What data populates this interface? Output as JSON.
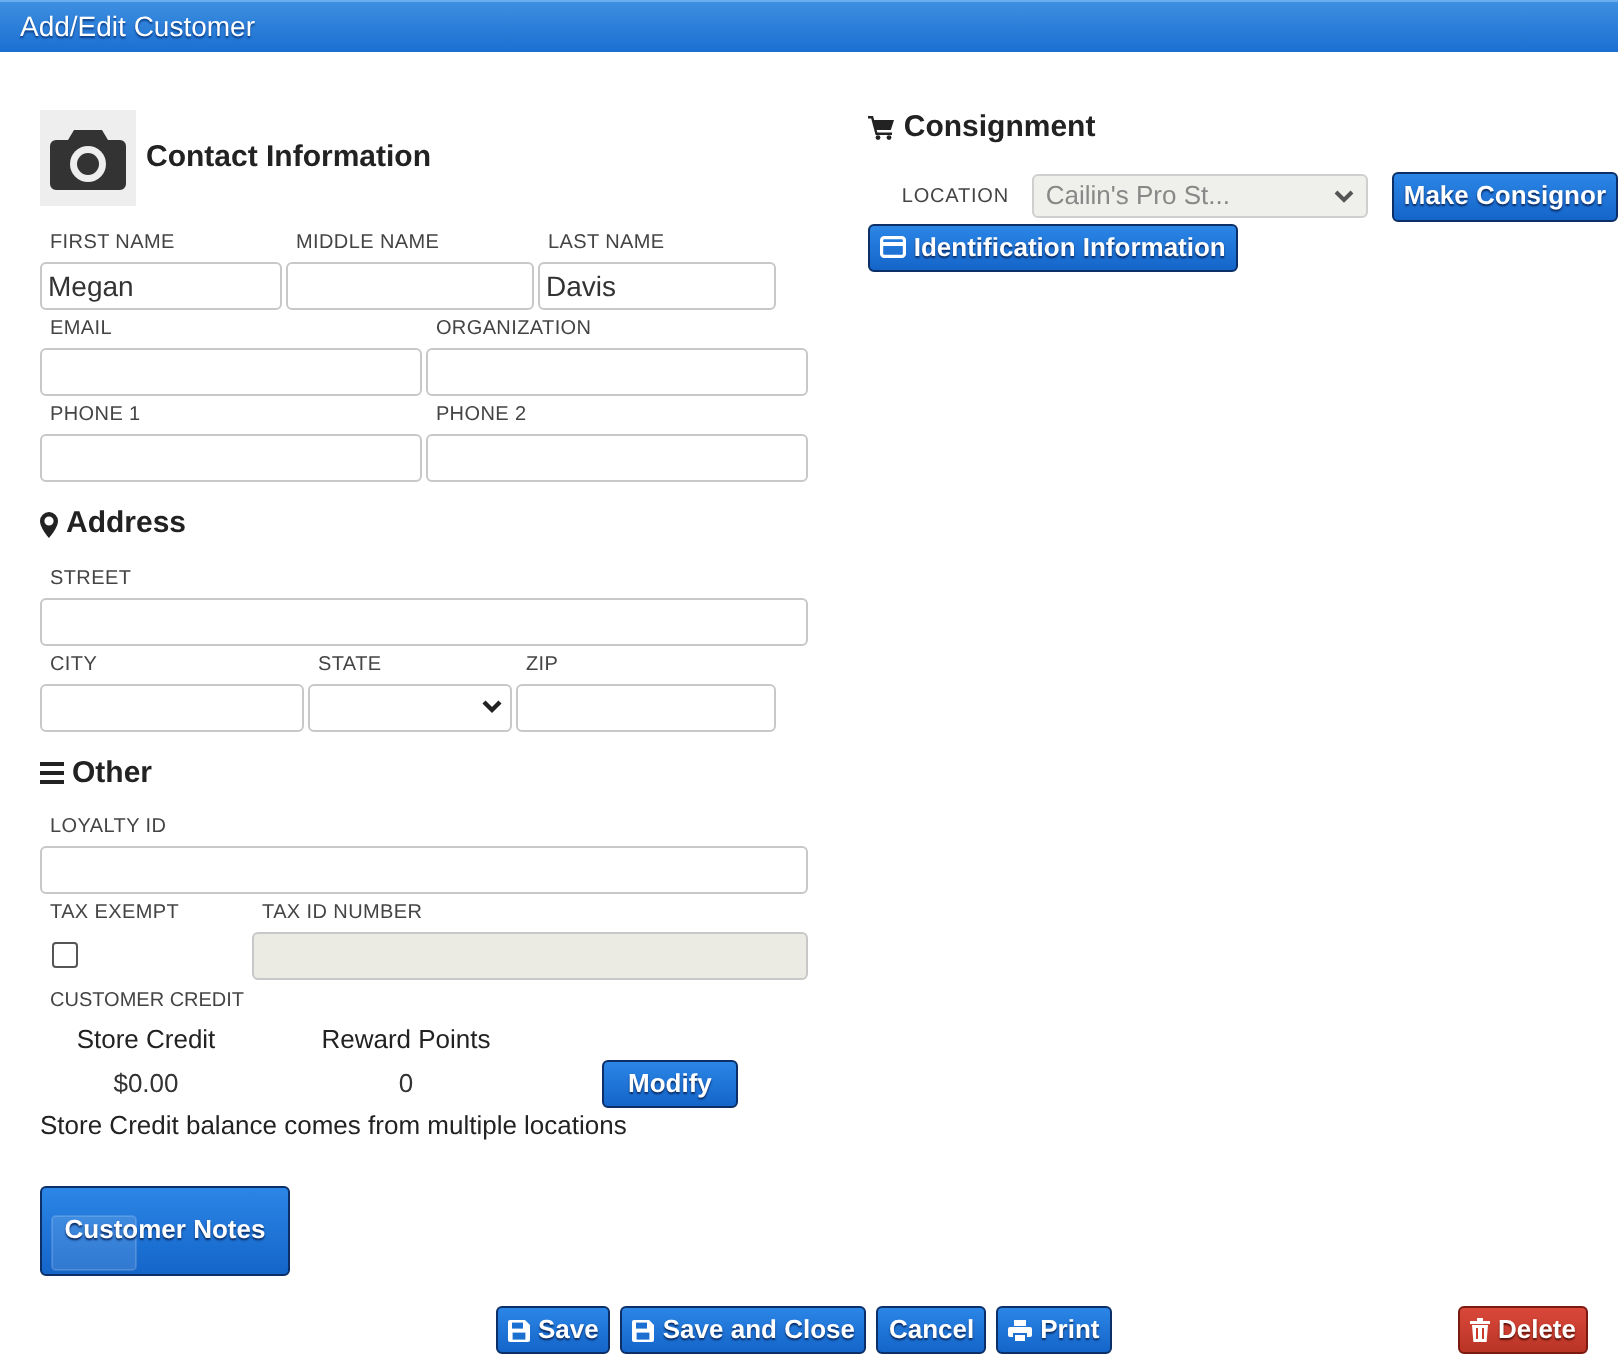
{
  "window": {
    "title": "Add/Edit Customer"
  },
  "contact": {
    "title": "Contact Information",
    "rows": [
      [
        {
          "kind": "text",
          "label": "FIRST NAME",
          "value": "Megan"
        },
        {
          "kind": "text",
          "label": "MIDDLE NAME"
        },
        {
          "kind": "text",
          "label": "LAST NAME",
          "value": "Davis"
        }
      ],
      [
        {
          "kind": "text",
          "label": "EMAIL"
        },
        {
          "kind": "text",
          "label": "ORGANIZATION"
        }
      ],
      [
        {
          "kind": "text",
          "label": "PHONE 1"
        },
        {
          "kind": "text",
          "label": "PHONE 2"
        }
      ]
    ]
  },
  "address": {
    "title": "Address",
    "rows": [
      [
        {
          "kind": "text",
          "label": "STREET"
        }
      ],
      [
        {
          "kind": "text",
          "label": "CITY"
        },
        {
          "kind": "select",
          "label": "STATE"
        },
        {
          "kind": "text",
          "label": "ZIP"
        }
      ]
    ]
  },
  "other": {
    "title": "Other",
    "rows": [
      [
        {
          "kind": "text",
          "label": "LOYALTY ID"
        }
      ],
      [
        {
          "kind": "checkbox",
          "label": "TAX EXEMPT",
          "checked": false
        },
        {
          "kind": "text",
          "label": "TAX ID NUMBER",
          "disabled": true
        }
      ]
    ]
  },
  "credit": {
    "label": "CUSTOMER CREDIT",
    "columns": [
      {
        "heading": "Store Credit",
        "value": "$0.00"
      },
      {
        "heading": "Reward Points",
        "value": "0"
      }
    ],
    "button": "Modify",
    "note": "Store Credit balance comes from multiple locations"
  },
  "notes_button": "Customer Notes",
  "consignment": {
    "title": "Consignment",
    "location_label": "LOCATION",
    "location_value": "Cailin's Pro St...",
    "location_disabled": true,
    "make_button": "Make Consignor",
    "id_button": "Identification Information"
  },
  "footer": {
    "buttons": [
      {
        "kind": "save",
        "label": "Save"
      },
      {
        "kind": "save",
        "label": "Save and Close"
      },
      {
        "kind": "plain",
        "label": "Cancel"
      },
      {
        "kind": "print",
        "label": "Print"
      },
      {
        "kind": "delete",
        "label": "Delete"
      }
    ]
  }
}
